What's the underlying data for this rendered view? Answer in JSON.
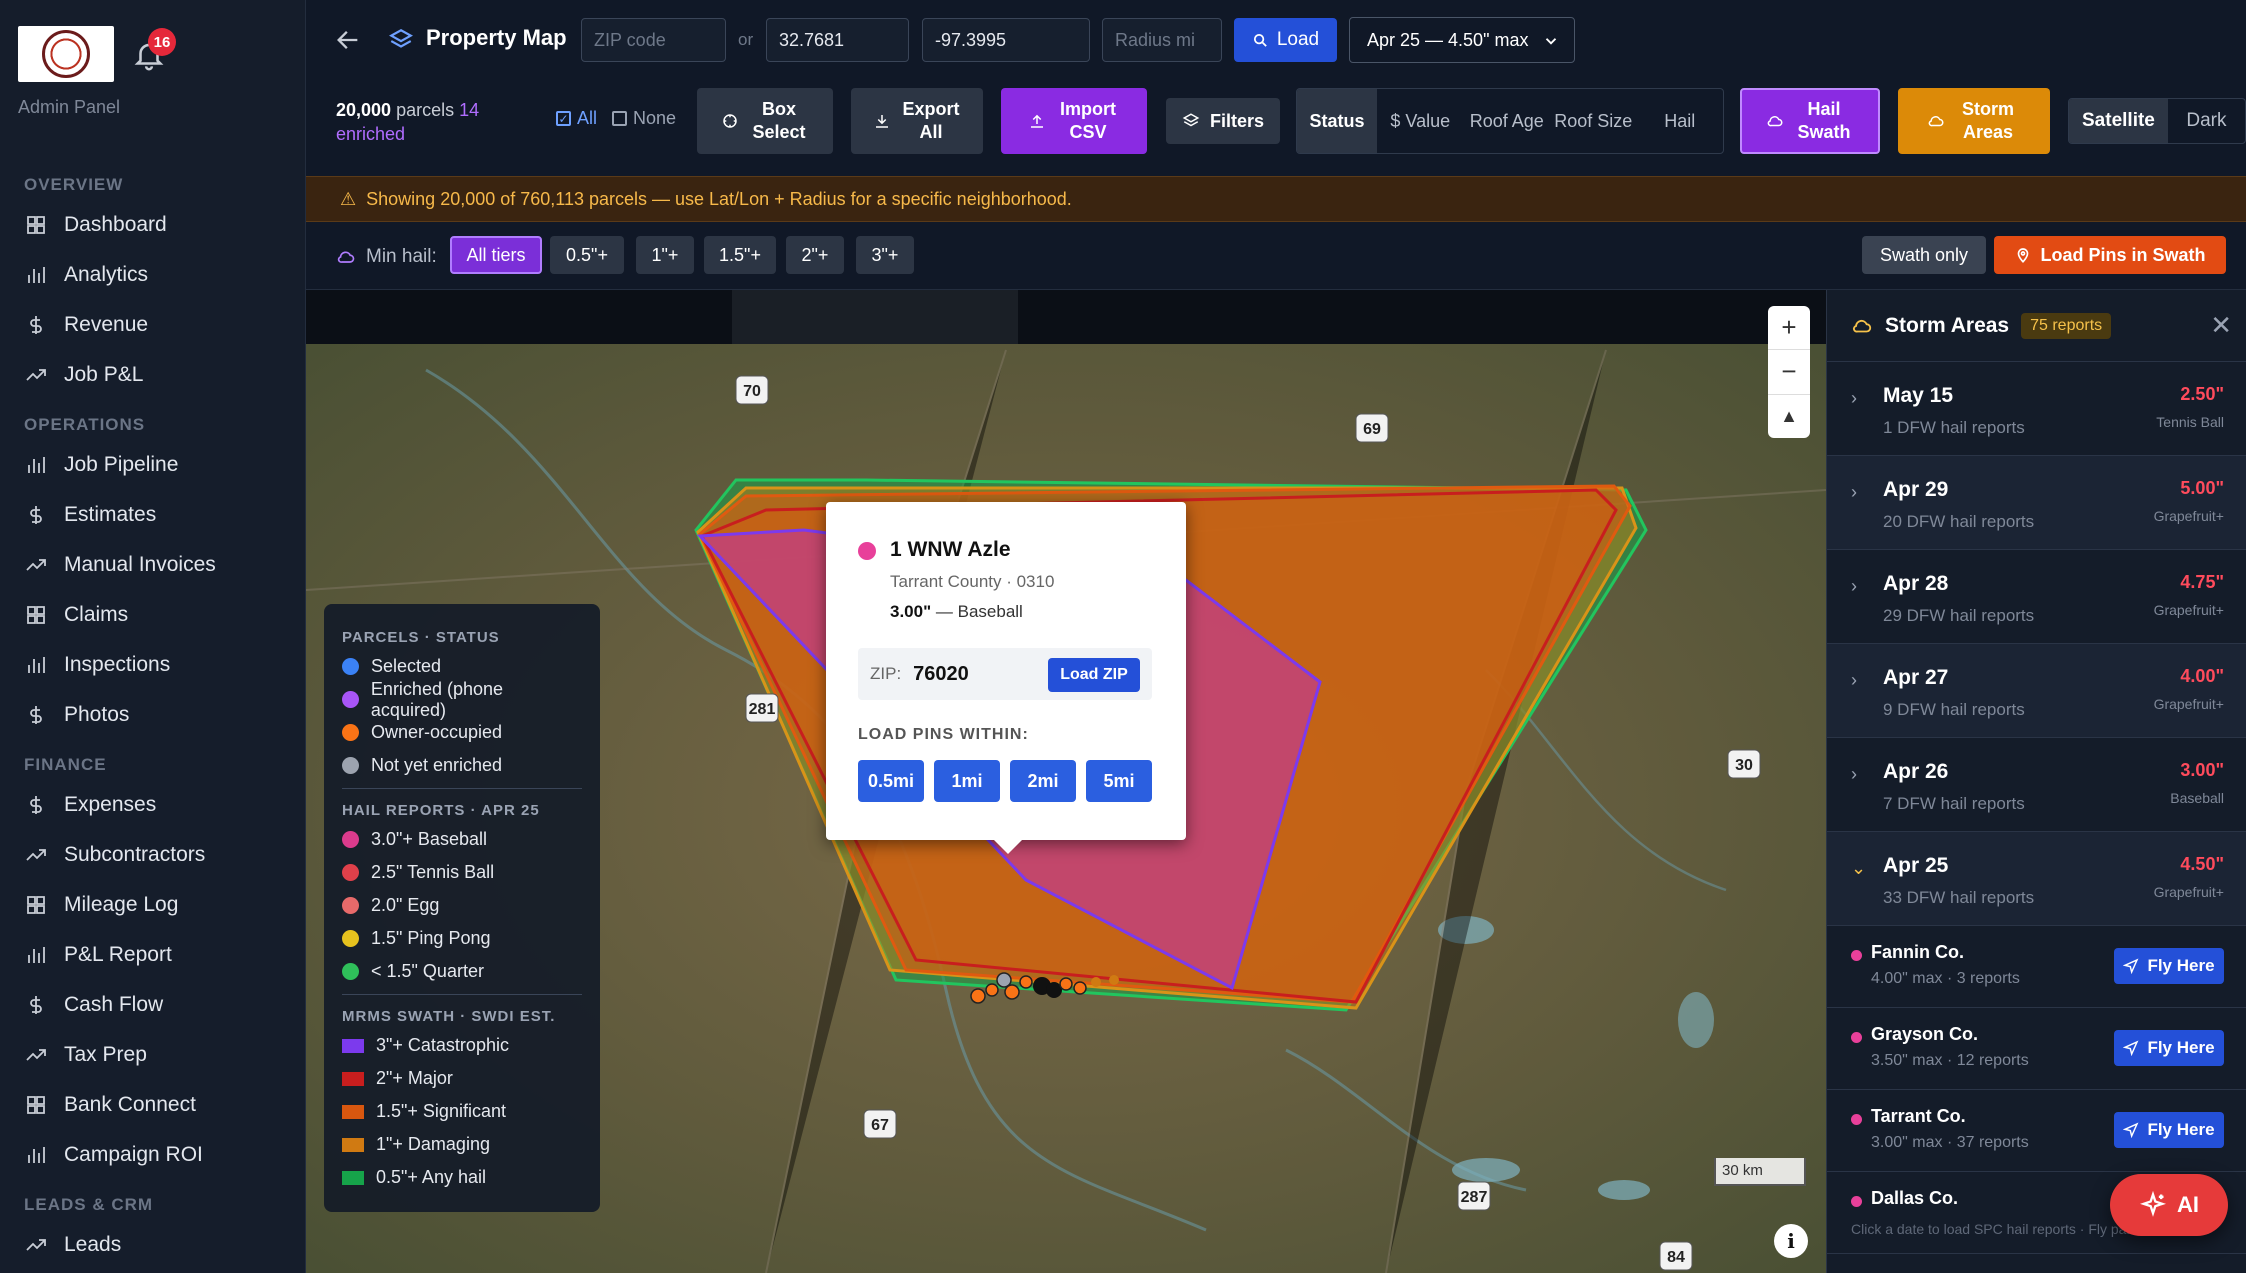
{
  "sidebar": {
    "notification_count": "16",
    "admin_label": "Admin Panel",
    "sections": [
      {
        "title": "OVERVIEW",
        "items": [
          "Dashboard",
          "Analytics",
          "Revenue",
          "Job P&L"
        ]
      },
      {
        "title": "OPERATIONS",
        "items": [
          "Job Pipeline",
          "Estimates",
          "Manual Invoices",
          "Claims",
          "Inspections",
          "Photos"
        ]
      },
      {
        "title": "FINANCE",
        "items": [
          "Expenses",
          "Subcontractors",
          "Mileage Log",
          "P&L Report",
          "Cash Flow",
          "Tax Prep",
          "Bank Connect",
          "Campaign ROI"
        ]
      },
      {
        "title": "LEADS & CRM",
        "items": [
          "Leads"
        ]
      }
    ]
  },
  "header": {
    "title": "Property Map",
    "zip_placeholder": "ZIP code",
    "or_label": "or",
    "lat_value": "32.7681",
    "lon_value": "-97.3995",
    "radius_placeholder": "Radius mi",
    "load_label": "Load",
    "date_select": "Apr 25 — 4.50\" max"
  },
  "toolbar": {
    "parcel_count": "20,000",
    "parcels_label": "parcels",
    "enriched_count": "14",
    "enriched_label": "enriched",
    "all_label": "All",
    "none_label": "None",
    "box_select": "Box Select",
    "export_all": "Export All",
    "import_csv": "Import CSV",
    "filters": "Filters",
    "status_tabs": [
      "Status",
      "$ Value",
      "Roof Age",
      "Roof Size",
      "Hail"
    ],
    "hail_swath": "Hail Swath",
    "storm_areas": "Storm Areas",
    "basemap": [
      "Satellite",
      "Dark"
    ]
  },
  "warning": "Showing 20,000 of 760,113 parcels — use Lat/Lon + Radius for a specific neighborhood.",
  "hail_filter": {
    "label": "Min hail:",
    "tiers": [
      "All tiers",
      "0.5\"+",
      "1\"+",
      "1.5\"+",
      "2\"+",
      "3\"+"
    ],
    "swath_only": "Swath only",
    "load_pins": "Load Pins in Swath"
  },
  "map": {
    "highway_labels": [
      "70",
      "69",
      "281",
      "30",
      "67",
      "287",
      "84"
    ],
    "scale": "30 km",
    "popup": {
      "title": "1 WNW Azle",
      "subtitle": "Tarrant County · 0310",
      "size": "3.00\"",
      "size_desc": "— Baseball",
      "zip_label": "ZIP:",
      "zip": "76020",
      "load_zip": "Load ZIP",
      "within_label": "LOAD PINS WITHIN:",
      "radii": [
        "0.5mi",
        "1mi",
        "2mi",
        "5mi"
      ]
    },
    "legend": {
      "parcels_title": "PARCELS · STATUS",
      "parcels": [
        {
          "label": "Selected",
          "color": "#3b82f6"
        },
        {
          "label": "Enriched (phone acquired)",
          "color": "#a855f7"
        },
        {
          "label": "Owner-occupied",
          "color": "#f97316"
        },
        {
          "label": "Not yet enriched",
          "color": "#9ca3af"
        }
      ],
      "hail_title": "HAIL REPORTS · APR 25",
      "hail": [
        {
          "label": "3.0\"+ Baseball",
          "color": "#db3b8c"
        },
        {
          "label": "2.5\" Tennis Ball",
          "color": "#e0404a"
        },
        {
          "label": "2.0\" Egg",
          "color": "#e86a6a"
        },
        {
          "label": "1.5\" Ping Pong",
          "color": "#e6c21e"
        },
        {
          "label": "< 1.5\" Quarter",
          "color": "#2fbf5a"
        }
      ],
      "swath_title": "MRMS SWATH · SWDI EST.",
      "swath": [
        {
          "label": "3\"+ Catastrophic",
          "color": "#7c3aed"
        },
        {
          "label": "2\"+ Major",
          "color": "#c81e1e"
        },
        {
          "label": "1.5\"+ Significant",
          "color": "#d8570f"
        },
        {
          "label": "1\"+ Damaging",
          "color": "#d07a12"
        },
        {
          "label": "0.5\"+ Any hail",
          "color": "#16a34a"
        }
      ]
    }
  },
  "panel": {
    "title": "Storm Areas",
    "reports": "75 reports",
    "dates": [
      {
        "date": "May 15",
        "sub": "1 DFW hail reports",
        "max": "2.50\"",
        "size": "Tennis Ball",
        "expanded": false
      },
      {
        "date": "Apr 29",
        "sub": "20 DFW hail reports",
        "max": "5.00\"",
        "size": "Grapefruit+",
        "expanded": false
      },
      {
        "date": "Apr 28",
        "sub": "29 DFW hail reports",
        "max": "4.75\"",
        "size": "Grapefruit+",
        "expanded": false
      },
      {
        "date": "Apr 27",
        "sub": "9 DFW hail reports",
        "max": "4.00\"",
        "size": "Grapefruit+",
        "expanded": false
      },
      {
        "date": "Apr 26",
        "sub": "7 DFW hail reports",
        "max": "3.00\"",
        "size": "Baseball",
        "expanded": false
      },
      {
        "date": "Apr 25",
        "sub": "33 DFW hail reports",
        "max": "4.50\"",
        "size": "Grapefruit+",
        "expanded": true
      }
    ],
    "counties": [
      {
        "name": "Fannin Co.",
        "sub": "4.00\" max · 3 reports"
      },
      {
        "name": "Grayson Co.",
        "sub": "3.50\" max · 12 reports"
      },
      {
        "name": "Tarrant Co.",
        "sub": "3.00\" max · 37 reports"
      },
      {
        "name": "Dallas Co.",
        "sub": ""
      }
    ],
    "fly_label": "Fly Here",
    "footer": "Click a date to load SPC hail reports · Fly parcels"
  },
  "ai_label": "AI"
}
